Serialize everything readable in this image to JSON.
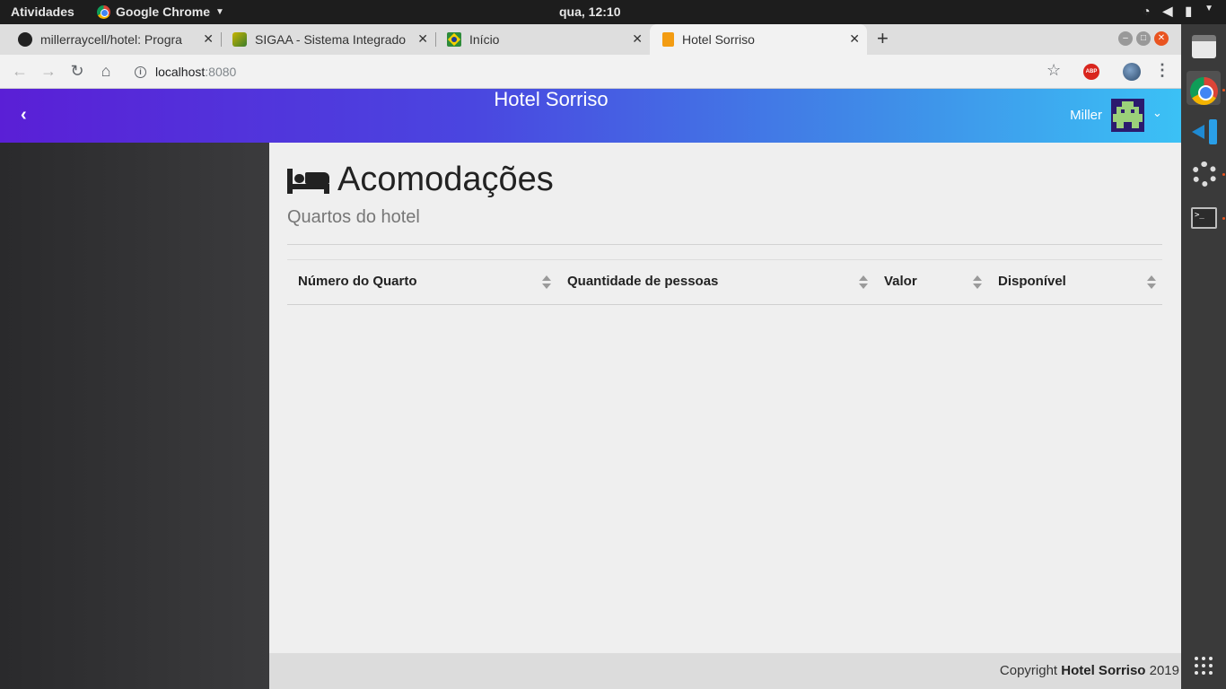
{
  "system": {
    "activities": "Atividades",
    "app_name": "Google Chrome",
    "clock": "qua, 12:10"
  },
  "browser": {
    "tabs": [
      {
        "title": "millerraycell/hotel: Progra",
        "icon": "github-icon"
      },
      {
        "title": "SIGAA - Sistema Integrado",
        "icon": "sigaa-icon"
      },
      {
        "title": "Início",
        "icon": "brazil-flag-icon"
      },
      {
        "title": "Hotel Sorriso",
        "icon": "hotel-icon",
        "active": true
      }
    ],
    "url_host": "localhost",
    "url_port": ":8080"
  },
  "app": {
    "brand": "Hotel Sorriso",
    "user_name": "Miller",
    "page_title": "Acomodações",
    "page_subtitle": "Quartos do hotel",
    "table": {
      "columns": [
        "Número do Quarto",
        "Quantidade de pessoas",
        "Valor",
        "Disponível"
      ],
      "rows": []
    },
    "footer": {
      "prefix": "Copyright ",
      "brand": "Hotel Sorriso",
      "year": " 2019"
    }
  },
  "colors": {
    "header_gradient_start": "#5a1fd6",
    "header_gradient_end": "#3bc1f5",
    "ubuntu_accent": "#e95420"
  }
}
